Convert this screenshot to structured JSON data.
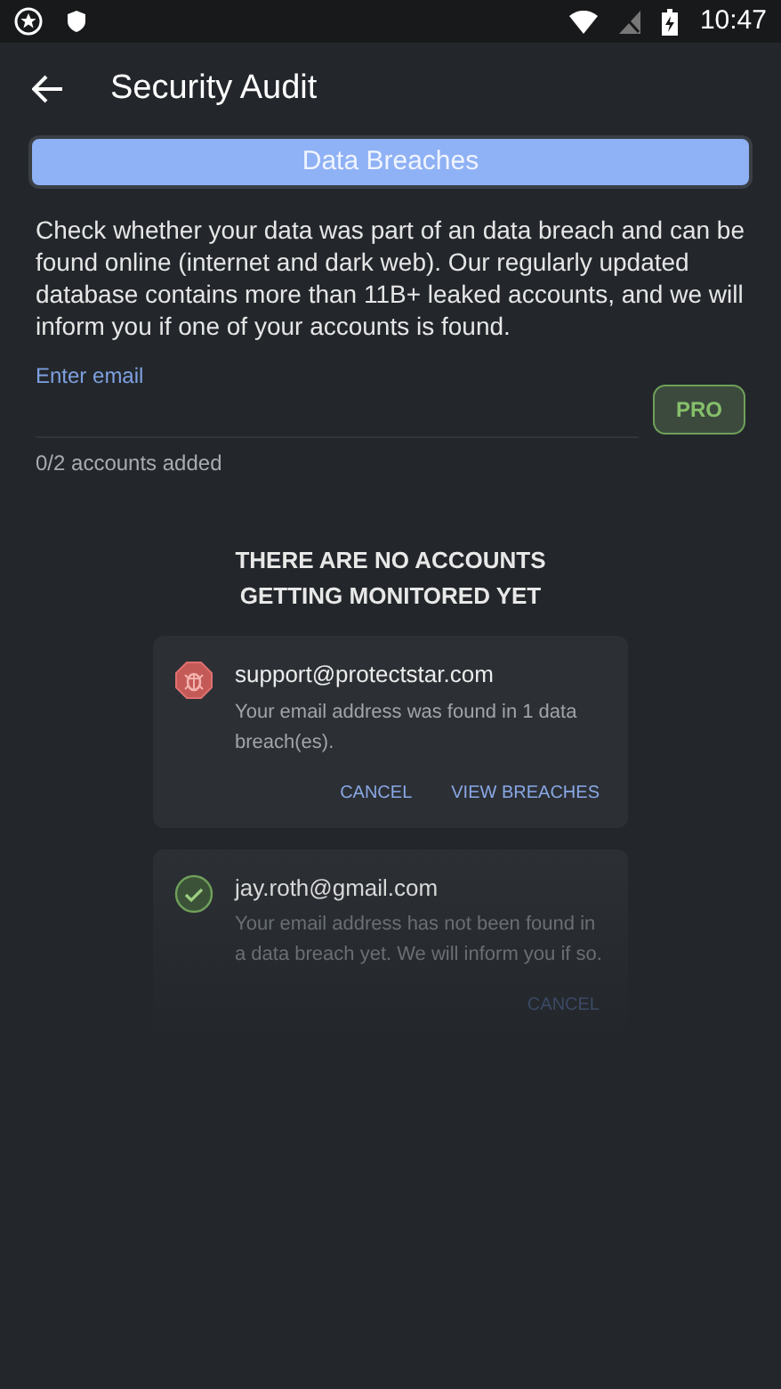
{
  "status_bar": {
    "time": "10:47"
  },
  "app_bar": {
    "title": "Security Audit"
  },
  "tabs": [
    {
      "label": "Data Breaches",
      "selected": true
    }
  ],
  "description": "Check whether your data was part of an data breach and can be found online (internet and dark web). Our regularly updated database contains more than 11B+ leaked accounts, and we will inform you if one of your accounts is found.",
  "email_field": {
    "label": "Enter email"
  },
  "pro_button": "PRO",
  "accounts_count": "0/2 accounts added",
  "empty_message": "THERE ARE NO ACCOUNTS GETTING MONITORED YET",
  "cards": [
    {
      "kind": "breached",
      "email": "support@protectstar.com",
      "message": "Your email address was found in 1 data breach(es).",
      "buttons": [
        "CANCEL",
        "VIEW BREACHES"
      ]
    },
    {
      "kind": "safe",
      "email": "jay.roth@gmail.com",
      "message": "Your email address has not been found in a data breach yet. We will inform you if so.",
      "buttons": [
        "CANCEL"
      ]
    }
  ]
}
